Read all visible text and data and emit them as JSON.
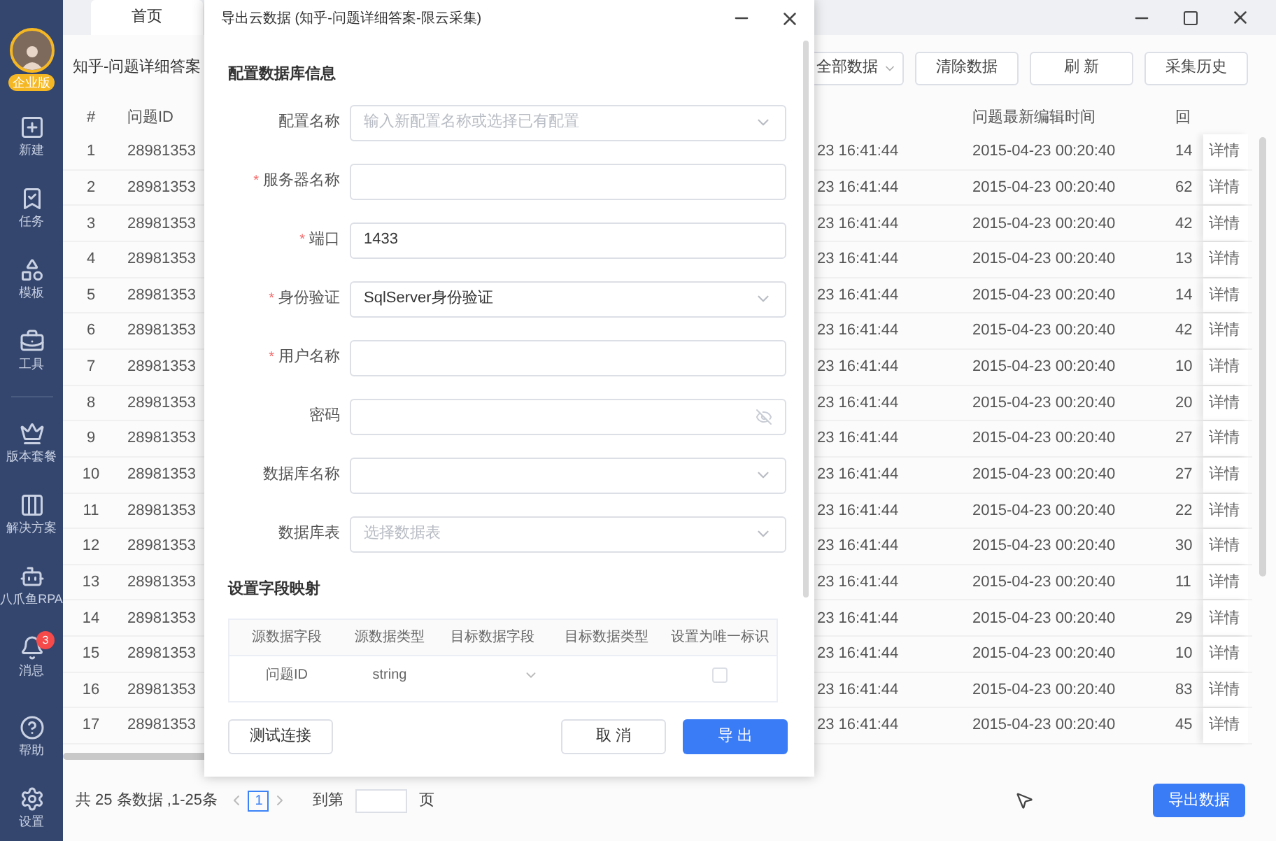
{
  "sidebar": {
    "avatar_badge": "企业版",
    "items": [
      {
        "label": "新建"
      },
      {
        "label": "任务"
      },
      {
        "label": "模板"
      },
      {
        "label": "工具"
      },
      {
        "label": "版本套餐"
      },
      {
        "label": "解决方案"
      },
      {
        "label": "八爪鱼RPA"
      },
      {
        "label": "消息",
        "badge": "3"
      },
      {
        "label": "帮助"
      },
      {
        "label": "设置"
      }
    ]
  },
  "tabs": [
    {
      "label": "首页",
      "selected": true
    }
  ],
  "page_title": "知乎-问题详细答案",
  "toolbar": [
    {
      "label": "全部数据",
      "kind": "dropdown"
    },
    {
      "label": "清除数据",
      "kind": "button"
    },
    {
      "label": "刷 新",
      "kind": "button"
    },
    {
      "label": "采集历史",
      "kind": "button"
    }
  ],
  "table": {
    "header": {
      "index": "#",
      "id": "问题ID",
      "edited": "问题最新编辑时间",
      "column_5": "回"
    },
    "rows": [
      {
        "index": "1",
        "id": "28981353",
        "column_3": "23 16:41:44",
        "edited": "2015-04-23 00:20:40",
        "column_5": "14",
        "action": "详情"
      },
      {
        "index": "2",
        "id": "28981353",
        "column_3": "23 16:41:44",
        "edited": "2015-04-23 00:20:40",
        "column_5": "62",
        "action": "详情"
      },
      {
        "index": "3",
        "id": "28981353",
        "column_3": "23 16:41:44",
        "edited": "2015-04-23 00:20:40",
        "column_5": "42",
        "action": "详情"
      },
      {
        "index": "4",
        "id": "28981353",
        "column_3": "23 16:41:44",
        "edited": "2015-04-23 00:20:40",
        "column_5": "13",
        "action": "详情"
      },
      {
        "index": "5",
        "id": "28981353",
        "column_3": "23 16:41:44",
        "edited": "2015-04-23 00:20:40",
        "column_5": "14",
        "action": "详情"
      },
      {
        "index": "6",
        "id": "28981353",
        "column_3": "23 16:41:44",
        "edited": "2015-04-23 00:20:40",
        "column_5": "42",
        "action": "详情"
      },
      {
        "index": "7",
        "id": "28981353",
        "column_3": "23 16:41:44",
        "edited": "2015-04-23 00:20:40",
        "column_5": "10",
        "action": "详情"
      },
      {
        "index": "8",
        "id": "28981353",
        "column_3": "23 16:41:44",
        "edited": "2015-04-23 00:20:40",
        "column_5": "20",
        "action": "详情"
      },
      {
        "index": "9",
        "id": "28981353",
        "column_3": "23 16:41:44",
        "edited": "2015-04-23 00:20:40",
        "column_5": "27",
        "action": "详情"
      },
      {
        "index": "10",
        "id": "28981353",
        "column_3": "23 16:41:44",
        "edited": "2015-04-23 00:20:40",
        "column_5": "27",
        "action": "详情"
      },
      {
        "index": "11",
        "id": "28981353",
        "column_3": "23 16:41:44",
        "edited": "2015-04-23 00:20:40",
        "column_5": "22",
        "action": "详情"
      },
      {
        "index": "12",
        "id": "28981353",
        "column_3": "23 16:41:44",
        "edited": "2015-04-23 00:20:40",
        "column_5": "30",
        "action": "详情"
      },
      {
        "index": "13",
        "id": "28981353",
        "column_3": "23 16:41:44",
        "edited": "2015-04-23 00:20:40",
        "column_5": "11",
        "action": "详情"
      },
      {
        "index": "14",
        "id": "28981353",
        "column_3": "23 16:41:44",
        "edited": "2015-04-23 00:20:40",
        "column_5": "29",
        "action": "详情"
      },
      {
        "index": "15",
        "id": "28981353",
        "column_3": "23 16:41:44",
        "edited": "2015-04-23 00:20:40",
        "column_5": "10",
        "action": "详情"
      },
      {
        "index": "16",
        "id": "28981353",
        "column_3": "23 16:41:44",
        "edited": "2015-04-23 00:20:40",
        "column_5": "83",
        "action": "详情"
      },
      {
        "index": "17",
        "id": "28981353",
        "column_3": "23 16:41:44",
        "edited": "2015-04-23 00:20:40",
        "column_5": "45",
        "action": "详情"
      }
    ]
  },
  "footer": {
    "summary": "共 25 条数据 ,1-25条",
    "pages": [
      {
        "label": "1",
        "selected": true
      }
    ],
    "goto_label": "到第",
    "goto_suffix": "页",
    "export_button": "导出数据"
  },
  "dialog": {
    "title": "导出云数据 (知乎-问题详细答案-限云采集)",
    "section_1": "配置数据库信息",
    "fields": [
      {
        "label": "配置名称",
        "kind": "select",
        "placeholder": "输入新配置名称或选择已有配置"
      },
      {
        "label": "服务器名称",
        "kind": "input",
        "mark": "*"
      },
      {
        "label": "端口",
        "kind": "input",
        "mark": "*",
        "value": "1433"
      },
      {
        "label": "身份验证",
        "kind": "select",
        "mark": "*",
        "value": "SqlServer身份验证"
      },
      {
        "label": "用户名称",
        "kind": "input",
        "mark": "*"
      },
      {
        "label": "密码",
        "kind": "password"
      },
      {
        "label": "数据库名称",
        "kind": "select"
      },
      {
        "label": "数据库表",
        "kind": "select",
        "placeholder": "选择数据表"
      }
    ],
    "section_2": "设置字段映射",
    "mapping": {
      "columns": [
        "源数据字段",
        "源数据类型",
        "目标数据字段",
        "目标数据类型",
        "设置为唯一标识"
      ],
      "rows": [
        {
          "source_field": "问题ID",
          "source_type": "string",
          "unique": false
        }
      ]
    },
    "buttons": {
      "test": "测试连接",
      "cancel": "取 消",
      "export": "导 出"
    }
  }
}
